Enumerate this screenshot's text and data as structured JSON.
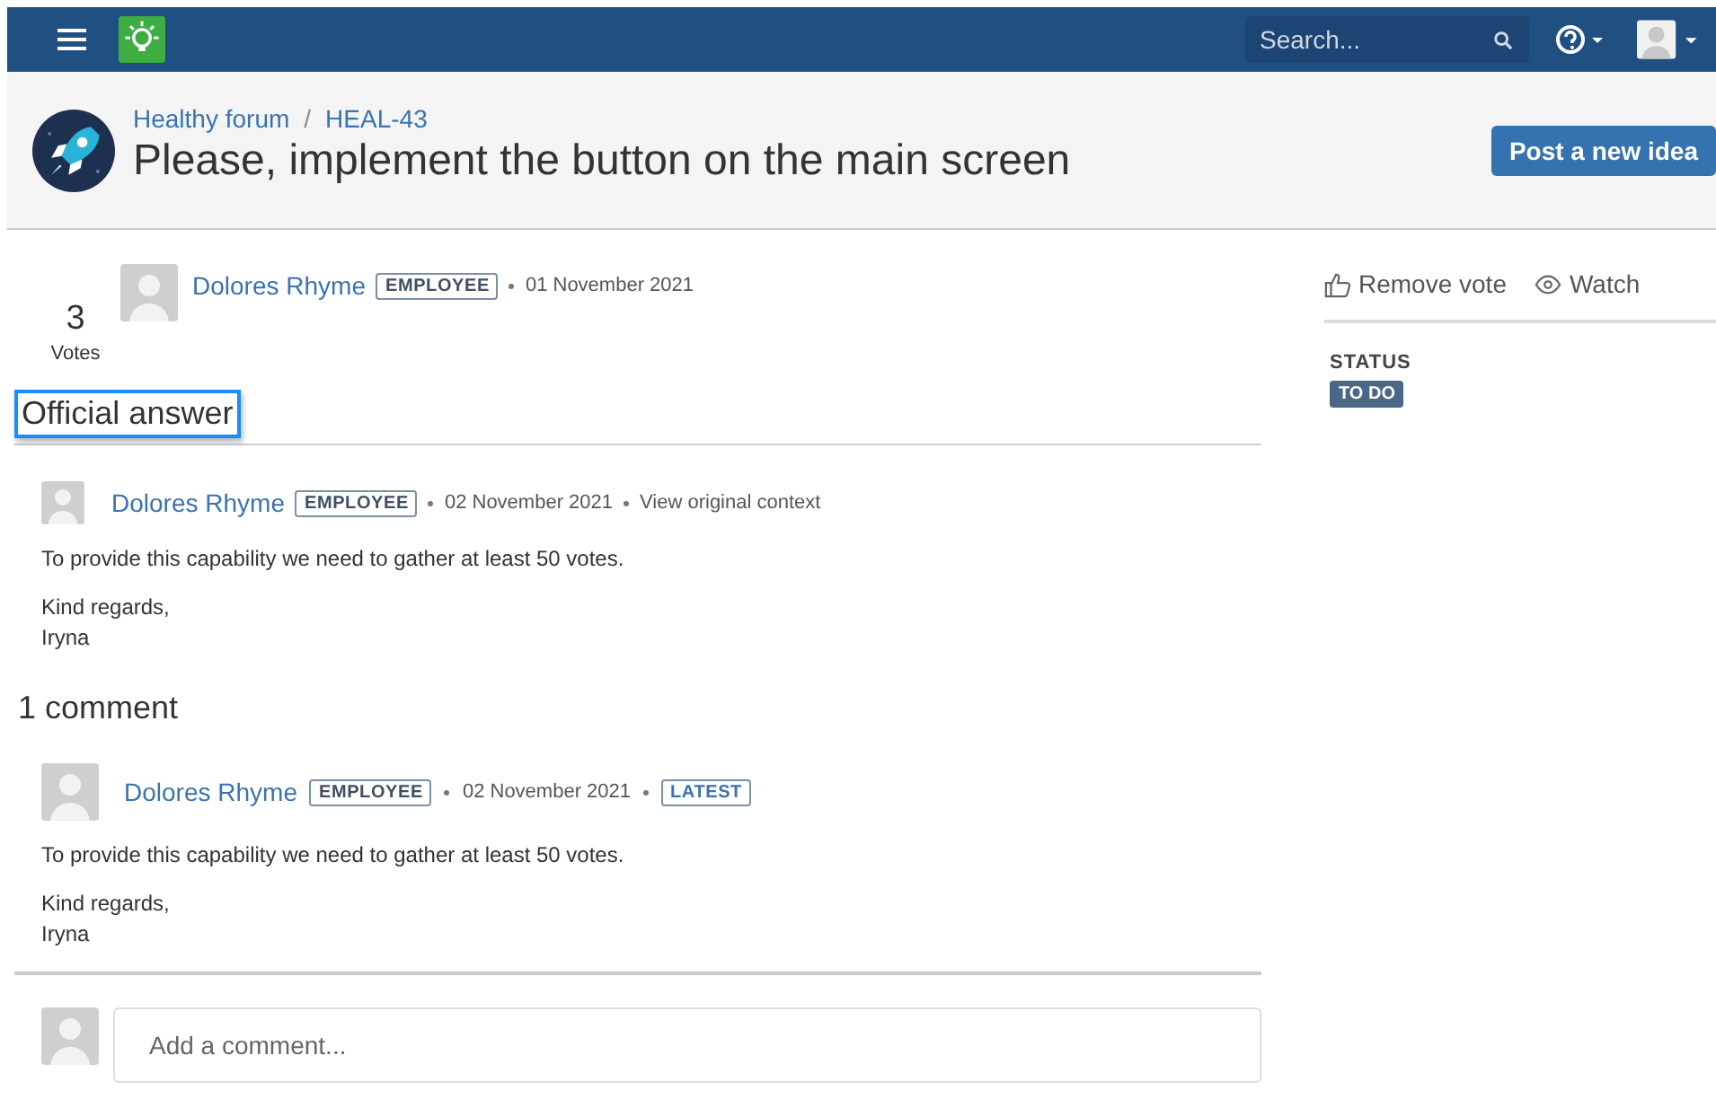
{
  "header": {
    "search": {
      "placeholder": "Search..."
    }
  },
  "page_header": {
    "breadcrumbs": [
      "Healthy forum",
      "HEAL-43"
    ],
    "breadcrumb_separator": "/",
    "title": "Please, implement the button on the main screen",
    "button": "Post a new idea"
  },
  "idea": {
    "votes": "3",
    "votes_label": "Votes",
    "author": "Dolores Rhyme",
    "badge": "EMPLOYEE",
    "date": "01 November 2021"
  },
  "sidebar": {
    "actions": [
      {
        "kind": "vote",
        "label": "Remove vote"
      },
      {
        "kind": "watch",
        "label": "Watch"
      }
    ],
    "status_label": "STATUS",
    "status": "TO DO"
  },
  "official_answer": {
    "heading": "Official answer",
    "highlighted": true,
    "author": "Dolores Rhyme",
    "badge": "EMPLOYEE",
    "date": "02 November 2021",
    "link": "View original context",
    "paragraphs": [
      [
        "To provide this capability we need to gather at least 50 votes."
      ],
      [
        "Kind regards,",
        "Iryna"
      ]
    ]
  },
  "comments": {
    "heading": "1 comment",
    "items": [
      {
        "author": "Dolores Rhyme",
        "badge": "EMPLOYEE",
        "date": "02 November 2021",
        "tag": "LATEST",
        "paragraphs": [
          [
            "To provide this capability we need to gather at least 50 votes."
          ],
          [
            "Kind regards,",
            "Iryna"
          ]
        ]
      }
    ]
  },
  "comment_box": {
    "placeholder": "Add a comment..."
  }
}
